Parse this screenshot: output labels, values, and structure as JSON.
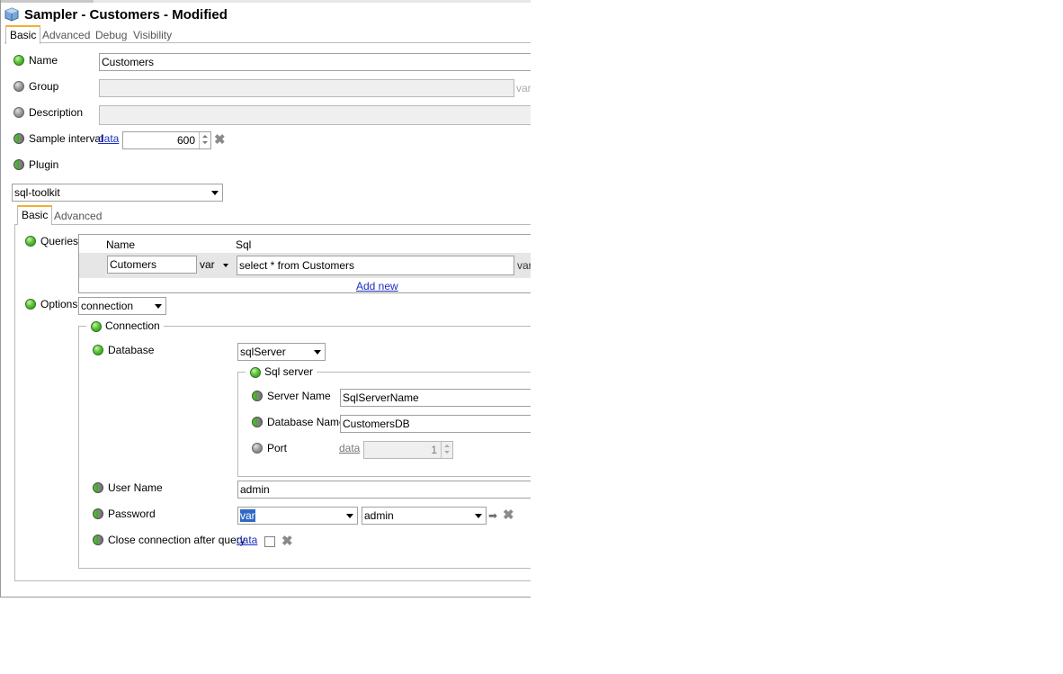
{
  "window": {
    "title": "Sampler - Customers - Modified"
  },
  "tabs": [
    "Basic",
    "Advanced",
    "Debug",
    "Visibility"
  ],
  "form": {
    "name": {
      "label": "Name",
      "value": "Customers"
    },
    "group": {
      "label": "Group",
      "value": "",
      "suffix": "var"
    },
    "description": {
      "label": "Description",
      "value": ""
    },
    "sample_interval": {
      "label": "Sample interval",
      "link": "data",
      "value": "600"
    },
    "plugin": {
      "label": "Plugin",
      "value": "sql-toolkit"
    }
  },
  "plugin_tabs": [
    "Basic",
    "Advanced"
  ],
  "queries": {
    "label": "Queries",
    "columns": [
      "Name",
      "Sql"
    ],
    "rows": [
      {
        "name": "Cutomers",
        "type": "var",
        "sql": "select * from Customers",
        "sql_suffix": "var"
      }
    ],
    "add_new": "Add new"
  },
  "options": {
    "label": "Options",
    "value": "connection",
    "connection": {
      "legend": "Connection",
      "database": {
        "label": "Database",
        "value": "sqlServer"
      },
      "sql_server": {
        "legend": "Sql server",
        "server_name": {
          "label": "Server Name",
          "value": "SqlServerName"
        },
        "database_name": {
          "label": "Database Name",
          "value": "CustomersDB"
        },
        "port": {
          "label": "Port",
          "link": "data",
          "value": "1"
        }
      },
      "user_name": {
        "label": "User Name",
        "value": "admin"
      },
      "password": {
        "label": "Password",
        "type": "var",
        "value": "admin"
      },
      "close_connection": {
        "label": "Close connection after query",
        "link": "data"
      }
    }
  }
}
